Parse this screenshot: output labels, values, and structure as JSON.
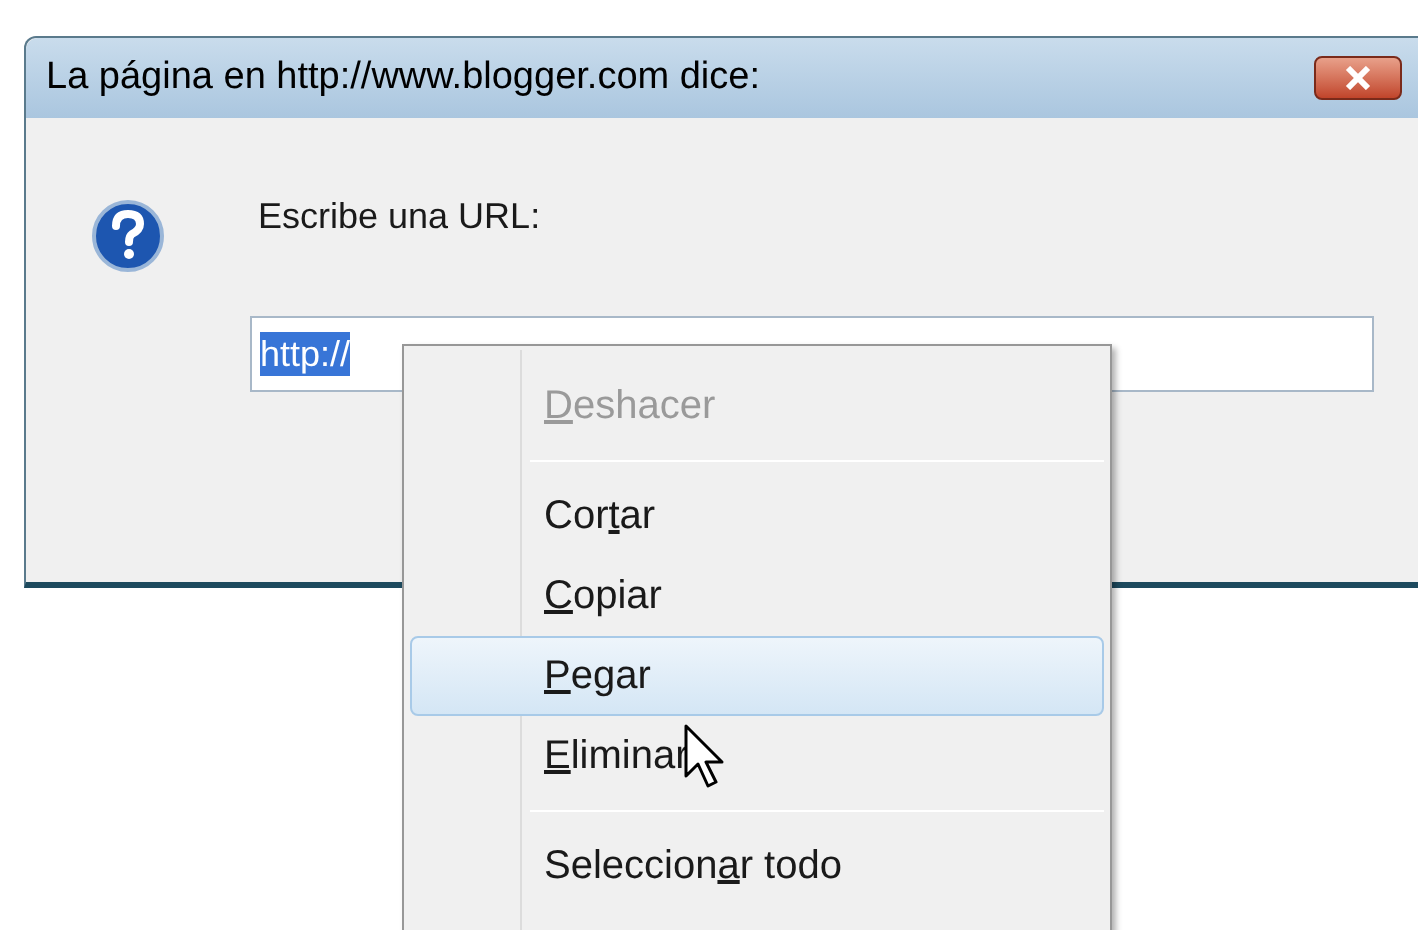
{
  "window": {
    "title": "La página en http://www.blogger.com dice:"
  },
  "prompt": {
    "message": "Escribe una URL:",
    "value": "http://"
  },
  "context_menu": {
    "items": [
      {
        "kind": "item",
        "key": "D",
        "end": "eshacer",
        "disabled": true,
        "selected": false
      },
      {
        "kind": "separator"
      },
      {
        "kind": "item",
        "start": "Cor",
        "key": "t",
        "end": "ar",
        "disabled": false,
        "selected": false
      },
      {
        "kind": "item",
        "key": "C",
        "end": "opiar",
        "disabled": false,
        "selected": false
      },
      {
        "kind": "item",
        "key": "P",
        "end": "egar",
        "disabled": false,
        "selected": true
      },
      {
        "kind": "item",
        "key": "E",
        "end": "liminar",
        "disabled": false,
        "selected": false
      },
      {
        "kind": "separator"
      },
      {
        "kind": "item",
        "start": "Seleccion",
        "key": "a",
        "end": "r todo",
        "disabled": false,
        "selected": false
      }
    ]
  }
}
